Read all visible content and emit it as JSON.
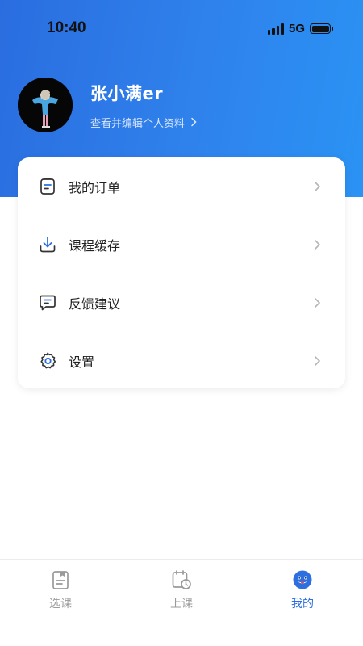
{
  "status_bar": {
    "time": "10:40",
    "network": "5G",
    "signal_icon": "cellular-signal-icon",
    "battery_icon": "battery-icon"
  },
  "profile": {
    "username": "张小满er",
    "edit_link": "查看并编辑个人资料",
    "chevron_icon": "chevron-right-icon",
    "avatar_icon": "avatar-image"
  },
  "menu": {
    "items": [
      {
        "label": "我的订单",
        "icon": "order-list-icon"
      },
      {
        "label": "课程缓存",
        "icon": "download-icon"
      },
      {
        "label": "反馈建议",
        "icon": "feedback-chat-icon"
      },
      {
        "label": "设置",
        "icon": "gear-icon"
      }
    ]
  },
  "tabbar": {
    "tabs": [
      {
        "label": "选课",
        "icon": "course-book-icon",
        "active": false
      },
      {
        "label": "上课",
        "icon": "calendar-clock-icon",
        "active": false
      },
      {
        "label": "我的",
        "icon": "mascot-profile-icon",
        "active": true
      }
    ]
  },
  "colors": {
    "header_gradient_start": "#2a6de0",
    "header_gradient_end": "#2a93f4",
    "accent": "#2d6fe0",
    "tab_inactive": "#9a9a9a"
  }
}
